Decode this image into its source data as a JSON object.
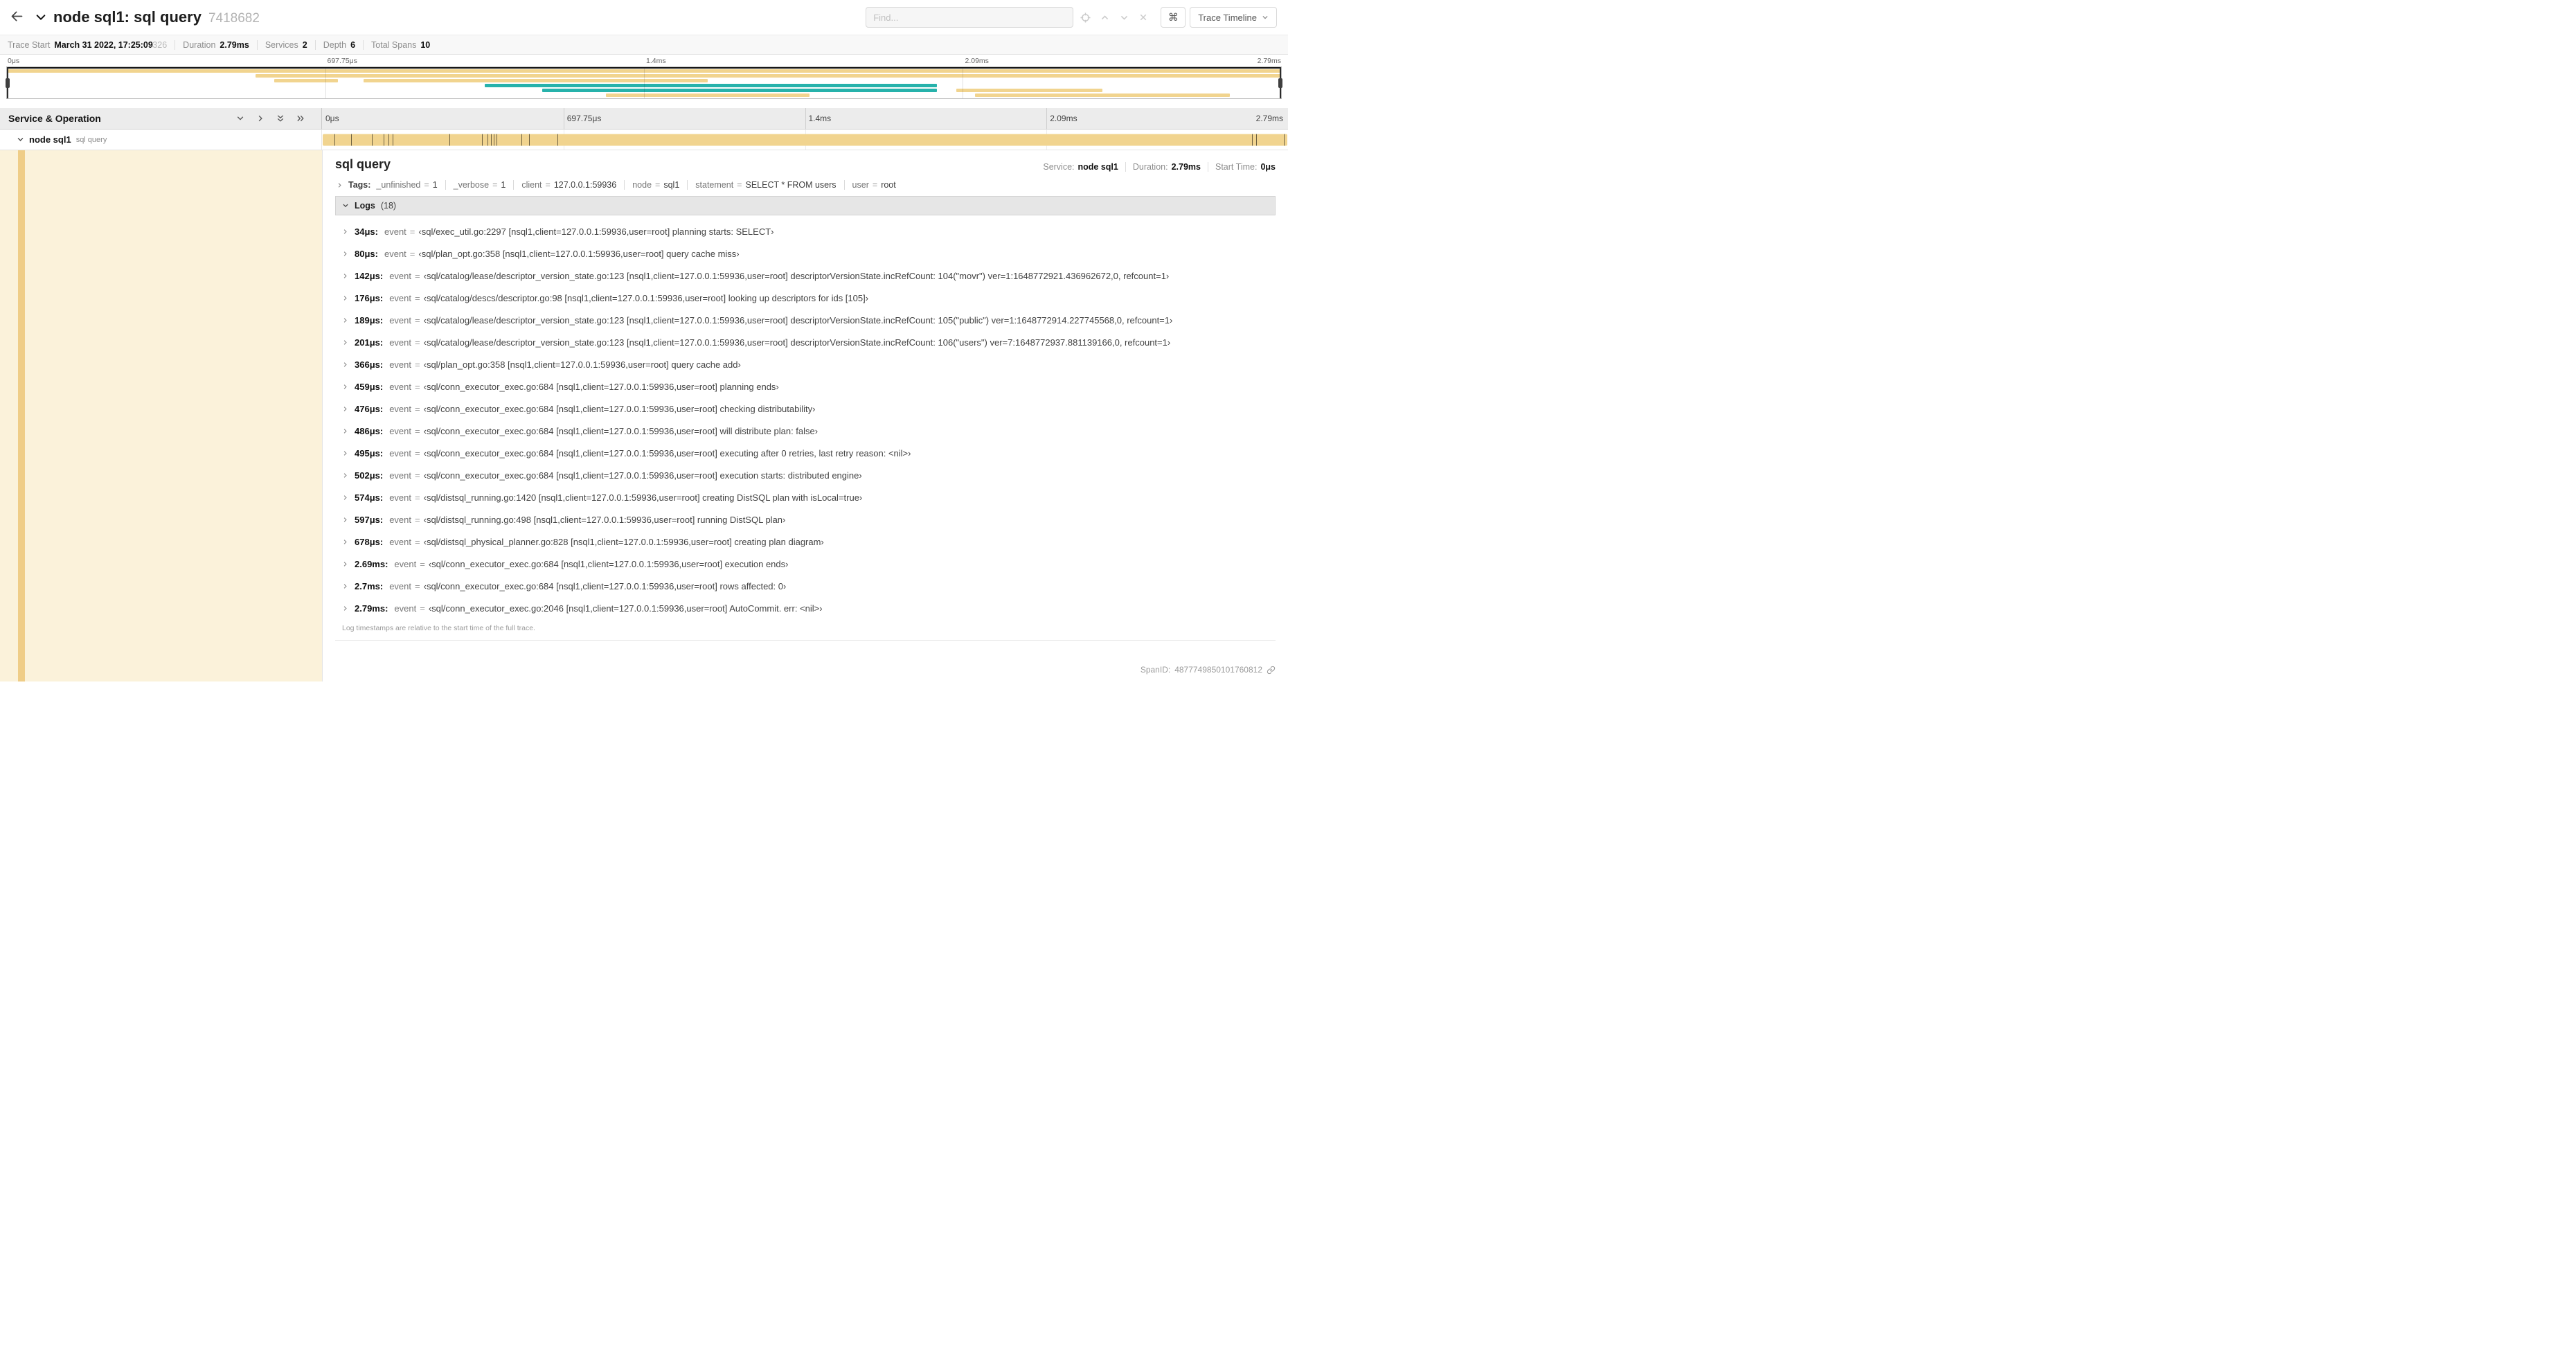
{
  "header": {
    "title": "node sql1: sql query",
    "trace_id_short": "7418682",
    "find_placeholder": "Find...",
    "cmd_glyph": "⌘",
    "view_selector": "Trace Timeline"
  },
  "summary": {
    "items": [
      {
        "label": "Trace Start",
        "value": "March 31 2022, 17:25:09",
        "suffix": ".326"
      },
      {
        "label": "Duration",
        "value": "2.79ms"
      },
      {
        "label": "Services",
        "value": "2"
      },
      {
        "label": "Depth",
        "value": "6"
      },
      {
        "label": "Total Spans",
        "value": "10"
      }
    ]
  },
  "ruler": {
    "ticks": [
      "0μs",
      "697.75μs",
      "1.4ms",
      "2.09ms",
      "2.79ms"
    ]
  },
  "minimap": {
    "colors": {
      "tan": "#f1d48f",
      "teal": "#27b2ab",
      "stripe": "#efcd87",
      "detail_fill": "#fbf2da"
    },
    "bars": [
      {
        "row": 0,
        "start": 0,
        "end": 100,
        "color": "tan"
      },
      {
        "row": 1,
        "start": 19.5,
        "end": 100,
        "color": "tan"
      },
      {
        "row": 2,
        "start": 21,
        "end": 26,
        "color": "tan"
      },
      {
        "row": 2,
        "start": 28,
        "end": 55,
        "color": "tan"
      },
      {
        "row": 3,
        "start": 37.5,
        "end": 73,
        "color": "teal"
      },
      {
        "row": 4,
        "start": 42,
        "end": 73,
        "color": "teal"
      },
      {
        "row": 4,
        "start": 74.5,
        "end": 86,
        "color": "tan"
      },
      {
        "row": 5,
        "start": 47,
        "end": 63,
        "color": "tan"
      },
      {
        "row": 5,
        "start": 76,
        "end": 96,
        "color": "tan"
      }
    ]
  },
  "timeline": {
    "left_header": "Service & Operation",
    "span": {
      "service": "node sql1",
      "operation": "sql query",
      "bar": {
        "start": 0.1,
        "end": 99.9
      },
      "log_ticks_pct": [
        1.2,
        2.9,
        5.1,
        6.3,
        6.8,
        7.2,
        13.1,
        16.5,
        17.1,
        17.4,
        17.7,
        18.0,
        20.6,
        21.4,
        24.3,
        96.4,
        96.8,
        99.7
      ]
    }
  },
  "detail": {
    "title": "sql query",
    "meta": [
      {
        "label": "Service:",
        "value": "node sql1"
      },
      {
        "label": "Duration:",
        "value": "2.79ms"
      },
      {
        "label": "Start Time:",
        "value": "0μs"
      }
    ],
    "tags_label": "Tags:",
    "eq": "=",
    "log_key": "event",
    "tags": [
      {
        "key": "_unfinished",
        "value": "1"
      },
      {
        "key": "_verbose",
        "value": "1"
      },
      {
        "key": "client",
        "value": "127.0.0.1:59936"
      },
      {
        "key": "node",
        "value": "sql1"
      },
      {
        "key": "statement",
        "value": "SELECT * FROM users"
      },
      {
        "key": "user",
        "value": "root"
      }
    ],
    "logs_label": "Logs",
    "logs_count": "(18)",
    "logs": [
      {
        "time": "34μs:",
        "value": "‹sql/exec_util.go:2297 [nsql1,client=127.0.0.1:59936,user=root] planning starts: SELECT›"
      },
      {
        "time": "80μs:",
        "value": "‹sql/plan_opt.go:358 [nsql1,client=127.0.0.1:59936,user=root] query cache miss›"
      },
      {
        "time": "142μs:",
        "value": "‹sql/catalog/lease/descriptor_version_state.go:123 [nsql1,client=127.0.0.1:59936,user=root] descriptorVersionState.incRefCount: 104(\"movr\") ver=1:1648772921.436962672,0, refcount=1›"
      },
      {
        "time": "176μs:",
        "value": "‹sql/catalog/descs/descriptor.go:98 [nsql1,client=127.0.0.1:59936,user=root] looking up descriptors for ids [105]›"
      },
      {
        "time": "189μs:",
        "value": "‹sql/catalog/lease/descriptor_version_state.go:123 [nsql1,client=127.0.0.1:59936,user=root] descriptorVersionState.incRefCount: 105(\"public\") ver=1:1648772914.227745568,0, refcount=1›"
      },
      {
        "time": "201μs:",
        "value": "‹sql/catalog/lease/descriptor_version_state.go:123 [nsql1,client=127.0.0.1:59936,user=root] descriptorVersionState.incRefCount: 106(\"users\") ver=7:1648772937.881139166,0, refcount=1›"
      },
      {
        "time": "366μs:",
        "value": "‹sql/plan_opt.go:358 [nsql1,client=127.0.0.1:59936,user=root] query cache add›"
      },
      {
        "time": "459μs:",
        "value": "‹sql/conn_executor_exec.go:684 [nsql1,client=127.0.0.1:59936,user=root] planning ends›"
      },
      {
        "time": "476μs:",
        "value": "‹sql/conn_executor_exec.go:684 [nsql1,client=127.0.0.1:59936,user=root] checking distributability›"
      },
      {
        "time": "486μs:",
        "value": "‹sql/conn_executor_exec.go:684 [nsql1,client=127.0.0.1:59936,user=root] will distribute plan: false›"
      },
      {
        "time": "495μs:",
        "value": "‹sql/conn_executor_exec.go:684 [nsql1,client=127.0.0.1:59936,user=root] executing after 0 retries, last retry reason: <nil>›"
      },
      {
        "time": "502μs:",
        "value": "‹sql/conn_executor_exec.go:684 [nsql1,client=127.0.0.1:59936,user=root] execution starts: distributed engine›"
      },
      {
        "time": "574μs:",
        "value": "‹sql/distsql_running.go:1420 [nsql1,client=127.0.0.1:59936,user=root] creating DistSQL plan with isLocal=true›"
      },
      {
        "time": "597μs:",
        "value": "‹sql/distsql_running.go:498 [nsql1,client=127.0.0.1:59936,user=root] running DistSQL plan›"
      },
      {
        "time": "678μs:",
        "value": "‹sql/distsql_physical_planner.go:828 [nsql1,client=127.0.0.1:59936,user=root] creating plan diagram›"
      },
      {
        "time": "2.69ms:",
        "value": "‹sql/conn_executor_exec.go:684 [nsql1,client=127.0.0.1:59936,user=root] execution ends›"
      },
      {
        "time": "2.7ms:",
        "value": "‹sql/conn_executor_exec.go:684 [nsql1,client=127.0.0.1:59936,user=root] rows affected: 0›"
      },
      {
        "time": "2.79ms:",
        "value": "‹sql/conn_executor_exec.go:2046 [nsql1,client=127.0.0.1:59936,user=root] AutoCommit. err: <nil>›"
      }
    ],
    "logs_note": "Log timestamps are relative to the start time of the full trace.",
    "span_id_label": "SpanID:",
    "span_id": "4877749850101760812"
  }
}
